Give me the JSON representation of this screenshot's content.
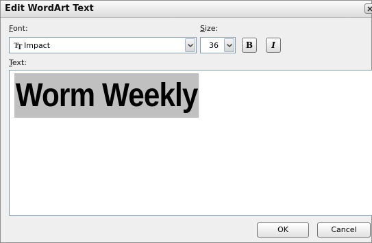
{
  "dialog": {
    "title": "Edit WordArt Text"
  },
  "font": {
    "label_key": "F",
    "label_rest": "ont:",
    "value": "Impact",
    "icon": "truetype-icon"
  },
  "size": {
    "label_key": "S",
    "label_rest": "ize:",
    "value": "36"
  },
  "format": {
    "bold_label": "B",
    "italic_label": "I"
  },
  "text": {
    "label_key": "T",
    "label_rest": "ext:",
    "value": "Worm Weekly"
  },
  "buttons": {
    "ok_label": "OK",
    "cancel_label": "Cancel"
  }
}
